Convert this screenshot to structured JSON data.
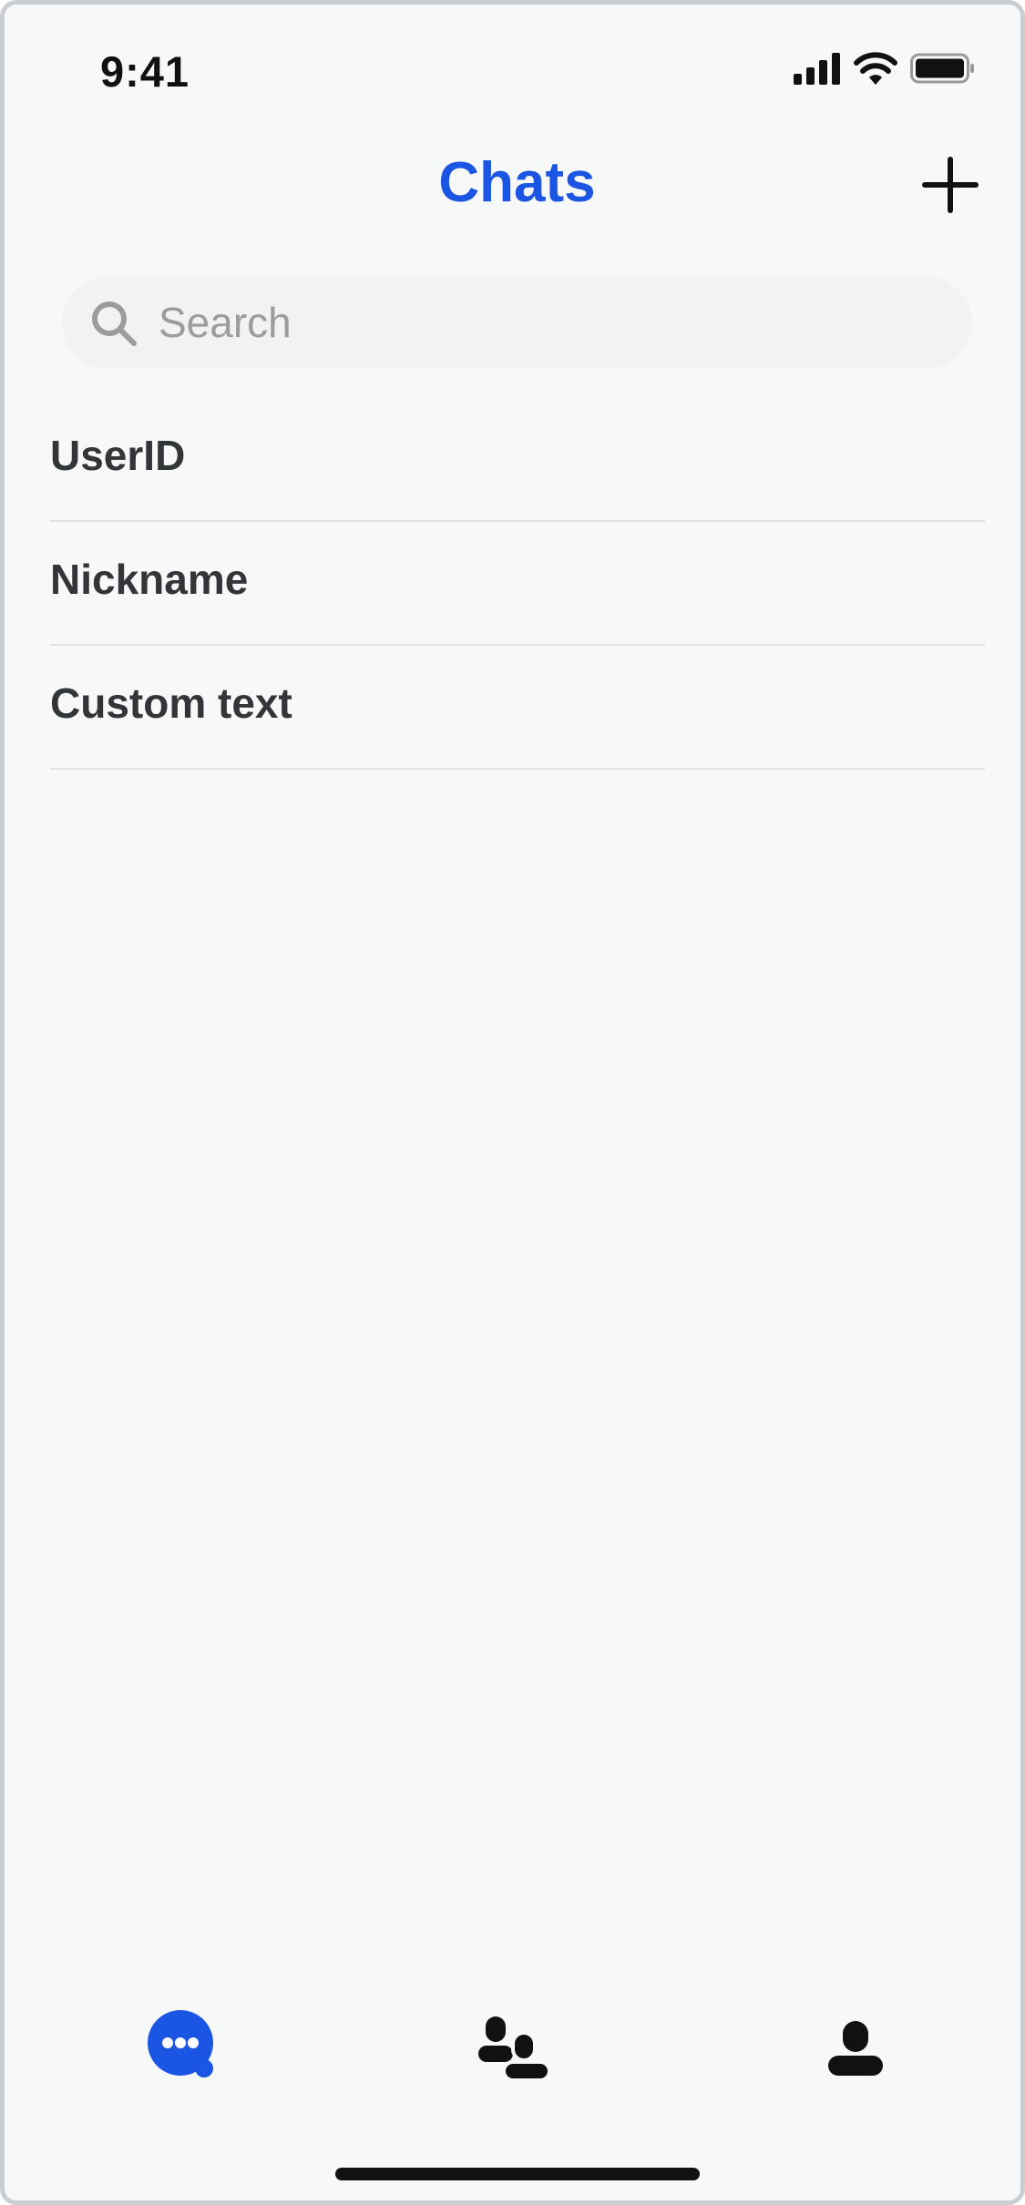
{
  "status_bar": {
    "time": "9:41"
  },
  "header": {
    "title": "Chats",
    "add_icon": "plus-icon"
  },
  "search": {
    "placeholder": "Search",
    "value": "",
    "icon": "search-icon"
  },
  "list": {
    "items": [
      {
        "label": "UserID"
      },
      {
        "label": "Nickname"
      },
      {
        "label": "Custom text"
      }
    ]
  },
  "tab_bar": {
    "tabs": [
      {
        "icon": "chat-bubble-icon",
        "selected": true
      },
      {
        "icon": "contacts-icon",
        "selected": false
      },
      {
        "icon": "profile-icon",
        "selected": false
      }
    ]
  },
  "colors": {
    "accent": "#1a55e3",
    "background": "#f7f9f9",
    "search_bg": "#f1f2f2",
    "text": "#333639",
    "divider": "#dfe3e5"
  }
}
